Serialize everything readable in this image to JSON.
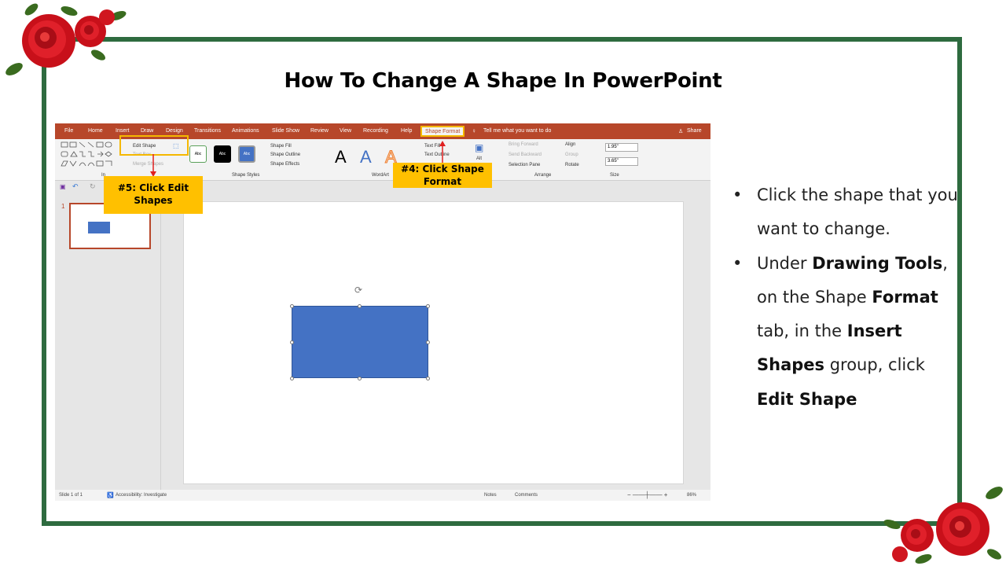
{
  "slide_title": "How To Change A Shape In PowerPoint",
  "menu_tabs": [
    "File",
    "Home",
    "Insert",
    "Draw",
    "Design",
    "Transitions",
    "Animations",
    "Slide Show",
    "Review",
    "View",
    "Recording",
    "Help",
    "Shape Format"
  ],
  "tell_me": "Tell me what you want to do",
  "share_label": "Share",
  "ribbon": {
    "edit_shape": "Edit Shape",
    "text_box": "Text Box",
    "merge_shapes": "Merge Shapes",
    "insert_group": "In",
    "style_labels": [
      "Abc",
      "Abc",
      "Abc"
    ],
    "shape_fill": "Shape Fill",
    "shape_outline": "Shape Outline",
    "shape_effects": "Shape Effects",
    "shape_styles_group": "Shape Styles",
    "wordart_letter": "A",
    "wordart_group": "WordArt",
    "text_fill": "Text Fill",
    "text_outline": "Text Outline",
    "alt_text": "Alt",
    "bring_forward": "Bring Forward",
    "send_backward": "Send Backward",
    "selection_pane": "Selection Pane",
    "align": "Align",
    "group": "Group",
    "rotate": "Rotate",
    "arrange_group": "Arrange",
    "height": "1.95\"",
    "width": "3.65\"",
    "size_group": "Size"
  },
  "thumbnail_number": "1",
  "status": {
    "slide_count": "Slide 1 of 1",
    "accessibility": "Accessibility: Investigate",
    "notes": "Notes",
    "comments": "Comments",
    "zoom": "86%"
  },
  "callouts": {
    "step5": "#5: Click Edit Shapes",
    "step4": "#4: Click Shape Format"
  },
  "instructions": {
    "b1": "Click the shape that you want to change.",
    "b2_p1": "Under ",
    "b2_b1": "Drawing Tools",
    "b2_p2": ", on the Shape ",
    "b2_b2": "Format",
    "b2_p3": " tab, in the ",
    "b2_b3": "Insert Shapes",
    "b2_p4": " group, click ",
    "b2_b4": "Edit Shape"
  },
  "colors": {
    "frame": "#2e6b3f",
    "ppt_red": "#b7472a",
    "callout": "#ffc000",
    "shape_fill": "#4472c4"
  }
}
